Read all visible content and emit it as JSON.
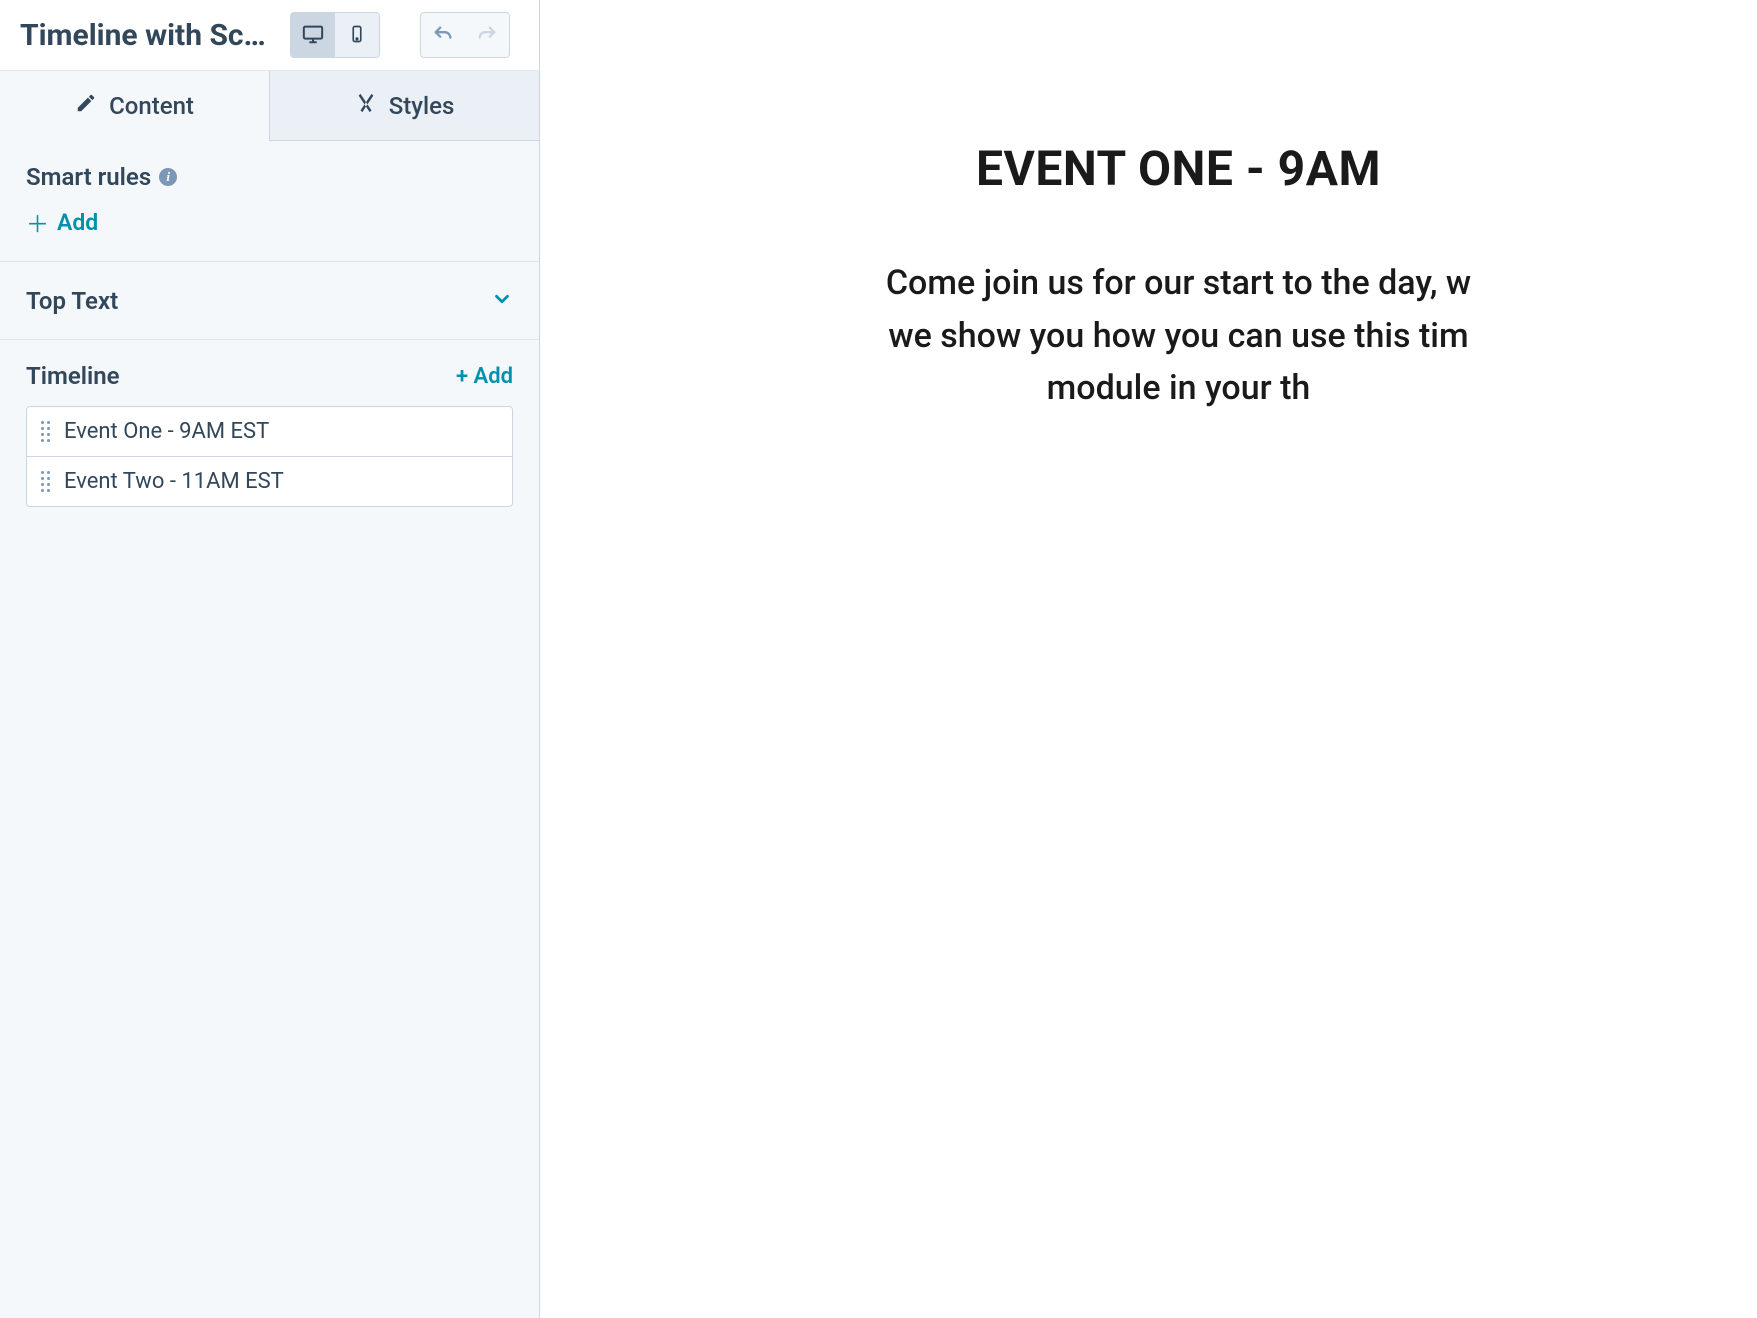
{
  "header": {
    "module_title": "Timeline with Sc…"
  },
  "tabs": {
    "content": "Content",
    "styles": "Styles"
  },
  "smart_rules": {
    "label": "Smart rules",
    "add": "Add"
  },
  "top_text": {
    "label": "Top Text"
  },
  "timeline": {
    "label": "Timeline",
    "add": "+ Add",
    "items": [
      {
        "label": "Event One - 9AM EST"
      },
      {
        "label": "Event Two - 11AM EST"
      }
    ]
  },
  "preview": {
    "title": "EVENT ONE - 9AM",
    "desc_line1": "Come join us for our start to the day, w",
    "desc_line2": "we show you how you can use this tim",
    "desc_line3": "module in your th"
  }
}
